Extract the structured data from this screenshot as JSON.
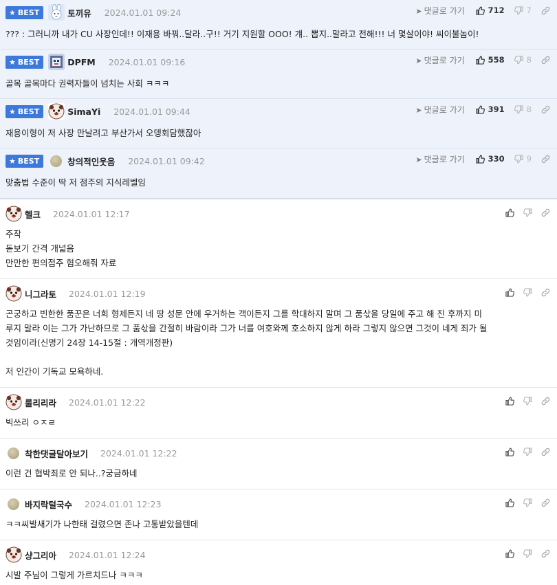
{
  "best_badge_label": "BEST",
  "goto_label": "댓글로 가기",
  "best_comments": [
    {
      "nick": "토끼유",
      "date": "2024.01.01 09:24",
      "text": "??? : 그러니까 내가 CU 사장인데!! 이재용 바꿔..달라..구!! 거기 지원할 OOO! 걔.. 뽑지..말라고 전해!!! 너 몇살이야! 씨이불놈이!",
      "up": "712",
      "down": "7",
      "avatar": "rabbit-avatar"
    },
    {
      "nick": "DPFM",
      "date": "2024.01.01 09:16",
      "text": "골목 골목마다 권력자들이 넘치는 사회 ㅋㅋㅋ",
      "up": "558",
      "down": "8",
      "avatar": "pixel-avatar"
    },
    {
      "nick": "SimaYi",
      "date": "2024.01.01 09:44",
      "text": "재용이형이 저 사장 만날려고 부산가서 오뎅회담했잖아",
      "up": "391",
      "down": "8",
      "avatar": "dog-avatar"
    },
    {
      "nick": "창의적인웃음",
      "date": "2024.01.01 09:42",
      "text": "맞춤법 수준이 딱 저 점주의 지식레벨임",
      "up": "330",
      "down": "9",
      "avatar": "dot-avatar"
    }
  ],
  "comments": [
    {
      "nick": "헬크",
      "date": "2024.01.01 12:17",
      "avatar": "dog-avatar",
      "lines": [
        "주작",
        "돋보기 간격 개넓음",
        "만만한 편의점주 혐오해줘 자료"
      ]
    },
    {
      "nick": "니그라토",
      "date": "2024.01.01 12:19",
      "avatar": "dog-avatar",
      "lines": [
        "곤궁하고 빈한한 품꾼은 너희 형제든지 네 땅 성문 안에 우거하는 객이든지 그를 학대하지 말며 그 품삯을 당일에 주고 해 진 후까지 미",
        "루지 말라 이는 그가 가난하므로 그 품삯을 간절히 바람이라 그가 너를 여호와께 호소하지 않게 하라 그렇지 않으면 그것이 네게 죄가 될",
        "것임이라(신명기 24장 14-15절 : 개역개정판)",
        "",
        "저 인간이 기독교 모욕하네."
      ]
    },
    {
      "nick": "룰리리라",
      "date": "2024.01.01 12:22",
      "avatar": "dog-avatar",
      "lines": [
        "빅쓰리 ㅇㅈㄹ"
      ]
    },
    {
      "nick": "착한댓글달아보기",
      "date": "2024.01.01 12:22",
      "avatar": "dot-avatar",
      "lines": [
        "이런 건 협박죄로 안 되나..?궁금하네"
      ]
    },
    {
      "nick": "바지락털국수",
      "date": "2024.01.01 12:23",
      "avatar": "dot-avatar",
      "lines": [
        "ㅋㅋ씨발새기가 나한태 걸렸으면 존나 고통받았을텐데"
      ]
    },
    {
      "nick": "샹그리아",
      "date": "2024.01.01 12:24",
      "avatar": "dog-avatar",
      "lines": [
        "시발 주님이 그렇게 가르치드나 ㅋㅋㅋ"
      ]
    }
  ],
  "colors": {
    "badge": "#3d78db",
    "best_bg": "#eef2fa",
    "date": "#999999"
  }
}
